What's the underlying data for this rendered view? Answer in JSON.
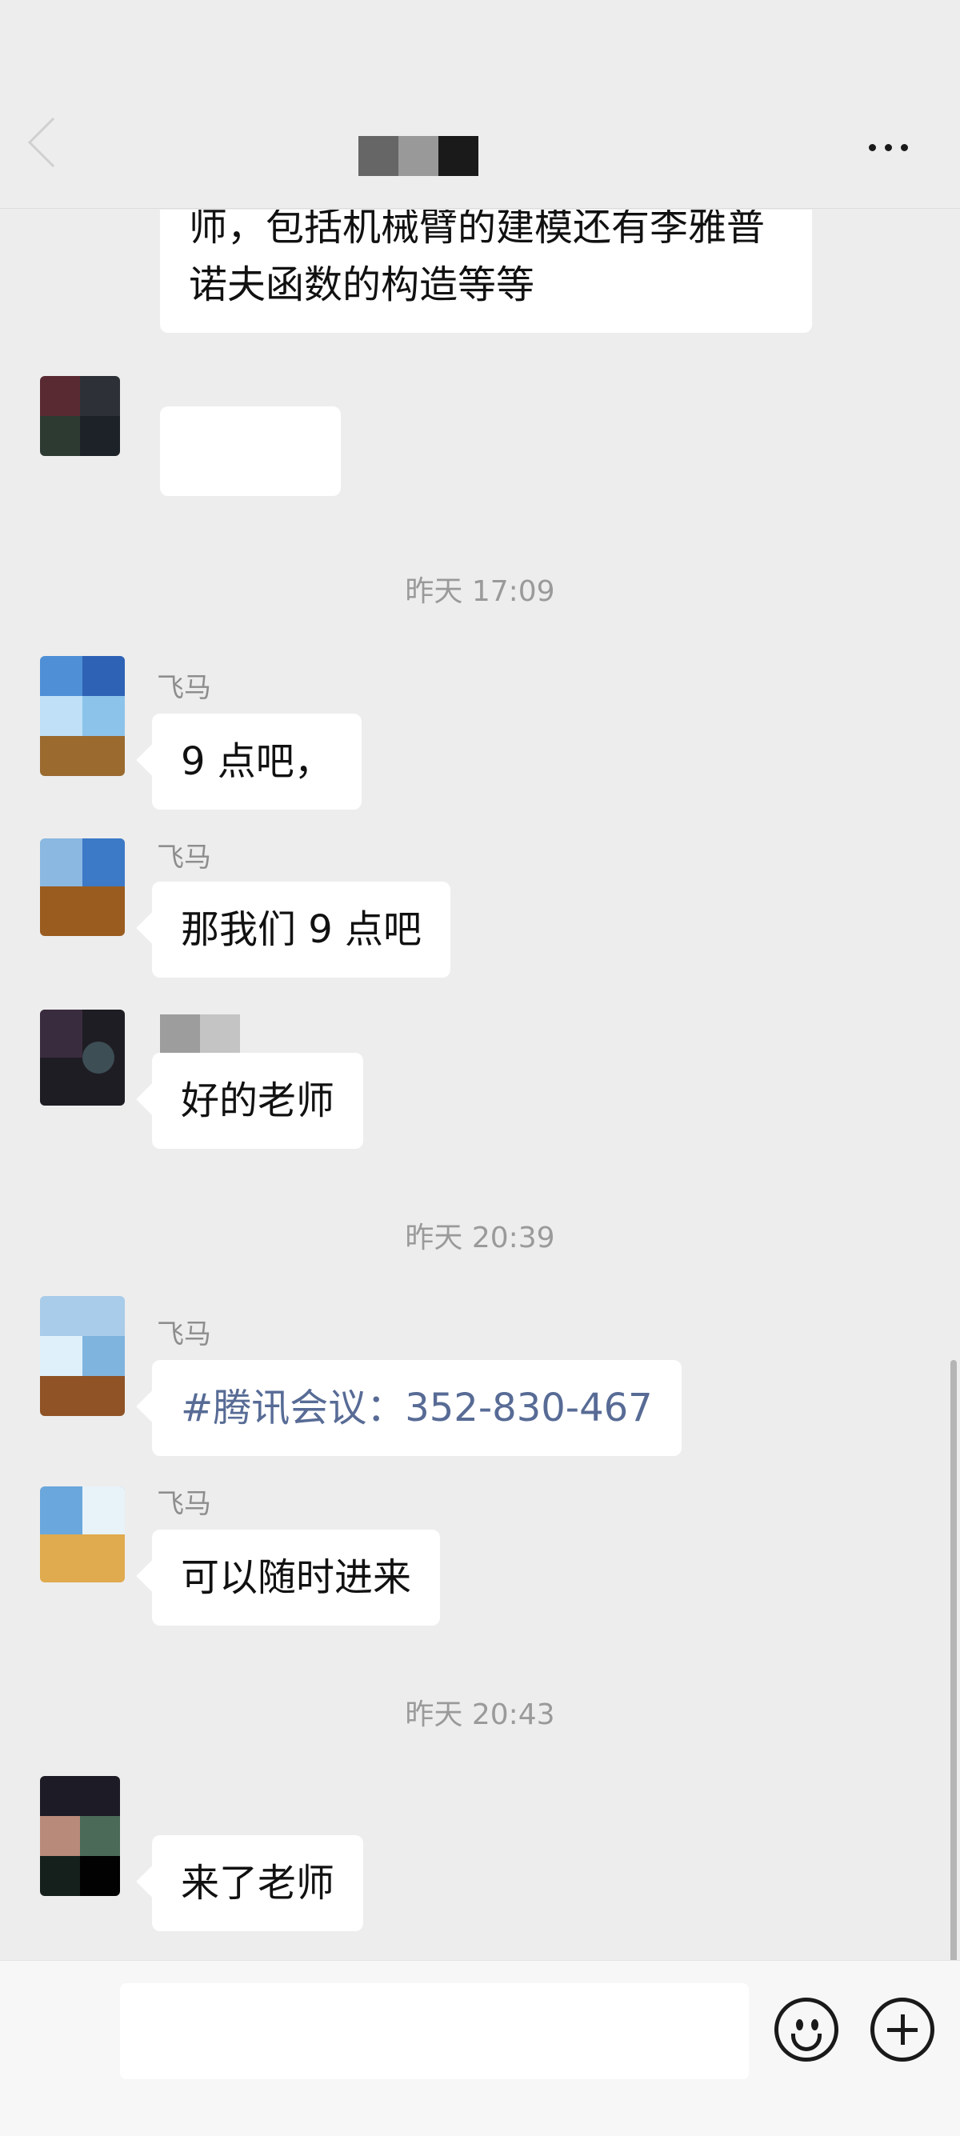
{
  "header": {
    "back_icon": "chevron-left-icon",
    "more_icon": "more-dots-icon",
    "title_colors": [
      "#666666",
      "#999999",
      "#1a1a1a"
    ]
  },
  "messages": {
    "m0_line1": "师，包括机械臂的建模还有李雅普",
    "m0_line2": "诺夫函数的构造等等",
    "ts1": "昨天 17:09",
    "sender1": "飞马",
    "m1": "9 点吧，",
    "sender2": "飞马",
    "m2": "那我们 9 点吧",
    "m3": "好的老师",
    "ts2": "昨天 20:39",
    "sender3": "飞马",
    "m4": "#腾讯会议：352-830-467",
    "sender4": "飞马",
    "m5": "可以随时进来",
    "ts3": "昨天 20:43",
    "m6": "来了老师"
  },
  "input": {
    "emoji_icon": "emoji-icon",
    "plus_icon": "plus-icon"
  },
  "colors": {
    "background": "#ededed",
    "bubble": "#ffffff",
    "link": "#576b95",
    "timestamp": "#9a9a9a"
  }
}
